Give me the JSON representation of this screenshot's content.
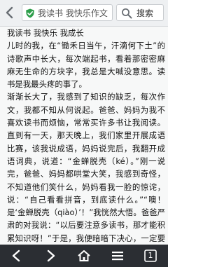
{
  "browser": {
    "url_text": "我读书 我快乐作文",
    "search_label": "搜索",
    "tab_count": "1"
  },
  "article": {
    "paragraphs": [
      "我读书 我快乐 我成长",
      "儿时的我，在“锄禾日当午，汗滴何下土”的诗歌声中长大，每次端起书，看着那密密麻麻无生命的方块字，我总是大喊没意思。读书是我最头疼的事了。",
      "渐渐长大了，我感到了知识的缺乏，每次作文，我都不知从何说起。爸爸、妈妈为我不喜欢读书而烦恼，常常买许多书让我阅读。直到有一天，那天晚上，我们家里开展成语比赛，该我说成语，妈妈说完后，我翻开成语词典，说道：“金蝉脱壳（ké）。”刚一说完，爸爸、妈妈都哄堂大笑，我感到奇怪，不知道他们笑什么，妈妈看我一脸的惊诧，说：“自己看看拼音，到底读什么。”“噢！是‘金蝉脱壳（qiào）’！”我恍然大悟。爸爸严肃的对我说：“以后要注意多读书，那才能积累知识呀！”于是，我便暗暗下决心，一定要多读书。"
    ]
  },
  "colors": {
    "topbar": "#eef0f2",
    "bottombar": "#2b2e33",
    "shield": "#2e9e4b",
    "text": "#111111"
  },
  "icons": [
    "back-arrow-icon",
    "shield-check-icon",
    "search-icon",
    "nav-back-icon",
    "nav-forward-icon",
    "home-icon",
    "menu-icon",
    "tabs-icon"
  ]
}
